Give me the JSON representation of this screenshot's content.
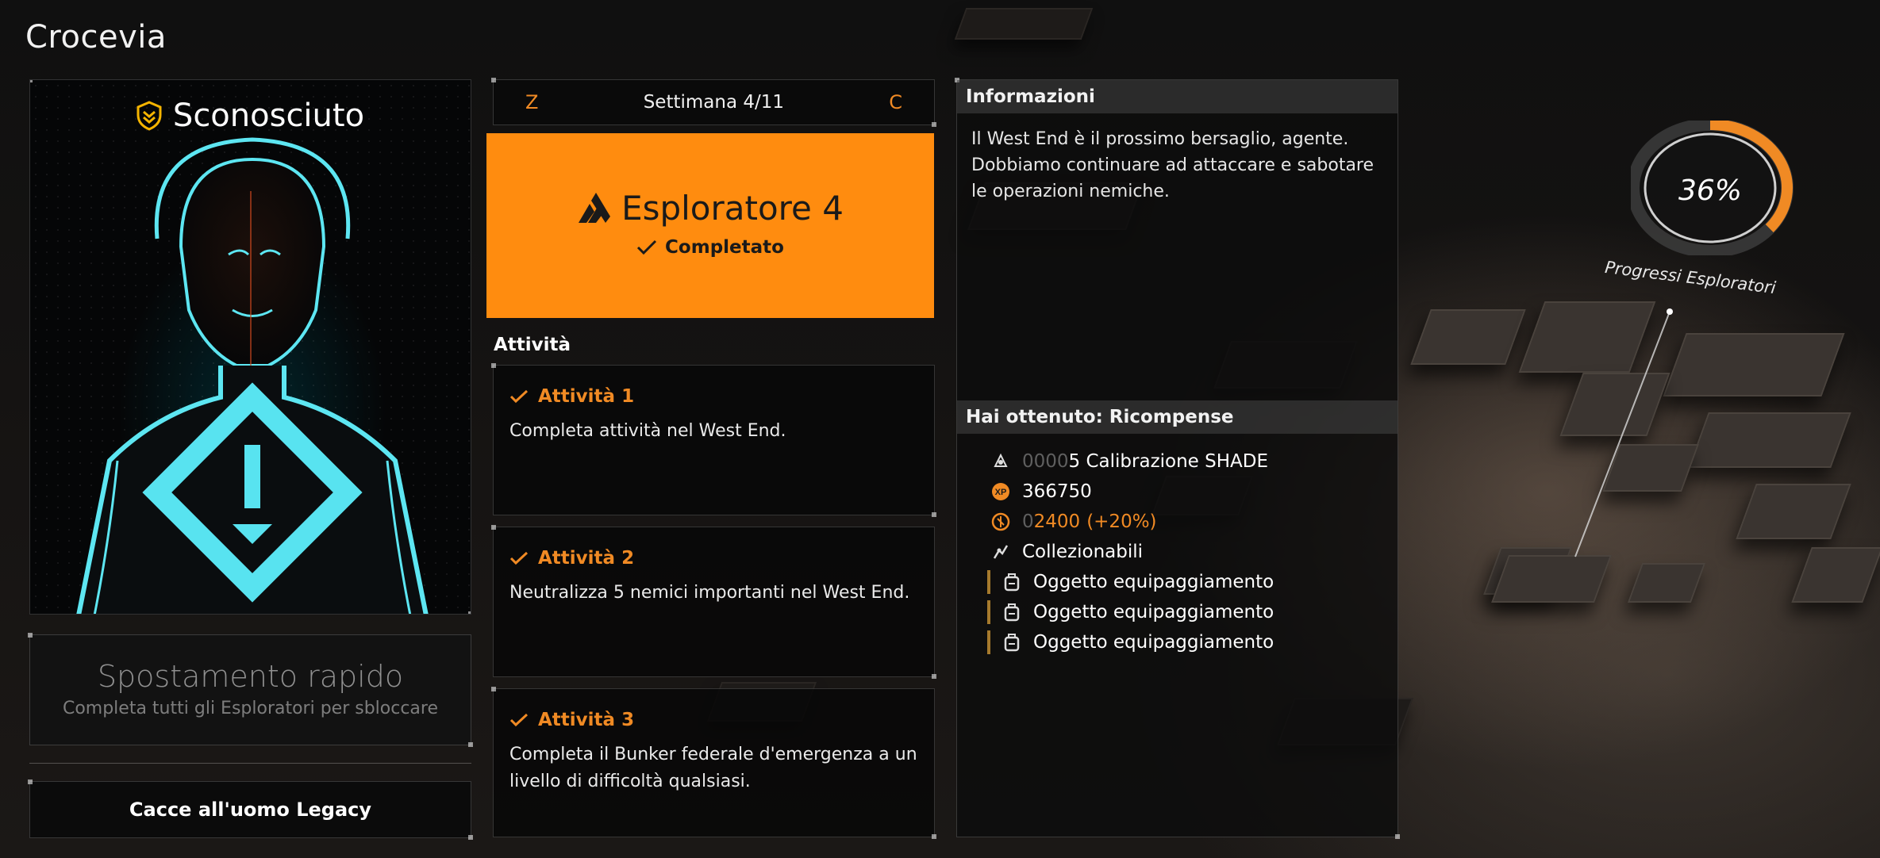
{
  "screen": {
    "title": "Crocevia"
  },
  "agent": {
    "rank_label": "Sconosciuto"
  },
  "fast_travel": {
    "title": "Spostamento rapido",
    "subtitle": "Completa tutti gli Esploratori per sbloccare"
  },
  "legacy_button": {
    "label": "Cacce all'uomo Legacy"
  },
  "week_nav": {
    "prev_key": "Z",
    "label": "Settimana 4/11",
    "next_key": "C"
  },
  "project": {
    "title": "Esploratore 4",
    "status": "Completato",
    "accent_color": "#ff8c0f"
  },
  "activities": {
    "header": "Attività",
    "items": [
      {
        "title": "Attività 1",
        "desc": "Completa attività nel West End."
      },
      {
        "title": "Attività 2",
        "desc": "Neutralizza 5 nemici importanti nel West End."
      },
      {
        "title": "Attività 3",
        "desc": "Completa il Bunker federale d'emergenza a un livello di difficoltà qualsiasi."
      }
    ]
  },
  "info": {
    "header": "Informazioni",
    "text": "Il West End è il prossimo bersaglio, agente. Dobbiamo continuare ad attaccare e sabotare le operazioni nemiche."
  },
  "rewards": {
    "header": "Hai ottenuto: Ricompense",
    "shade": {
      "icon": "shade-calibration-icon",
      "pad": "0000",
      "value": "5 Calibrazione SHADE"
    },
    "xp": {
      "icon": "xp-icon",
      "value": "366750"
    },
    "credits": {
      "icon": "dark-zone-credits-icon",
      "pad": "0",
      "value": "2400",
      "bonus": "(+20%)"
    },
    "collectibles": {
      "icon": "collectibles-icon",
      "label": "Collezionabili"
    },
    "gear": [
      {
        "icon": "backpack-icon",
        "label": "Oggetto equipaggiamento"
      },
      {
        "icon": "backpack-icon",
        "label": "Oggetto equipaggiamento"
      },
      {
        "icon": "backpack-icon",
        "label": "Oggetto equipaggiamento"
      }
    ]
  },
  "progress": {
    "value_text": "36%",
    "fraction": 0.36,
    "label": "Progressi Esploratori",
    "color": "#f08a24"
  }
}
